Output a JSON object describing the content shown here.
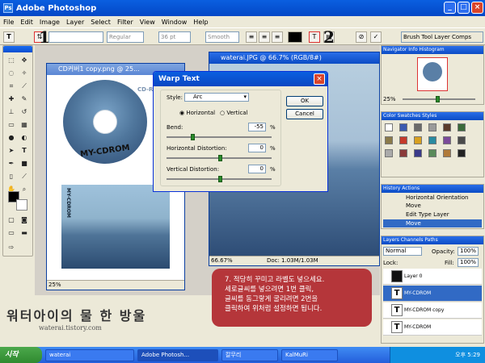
{
  "app": {
    "title": "Adobe Photoshop"
  },
  "menu": [
    "File",
    "Edit",
    "Image",
    "Layer",
    "Select",
    "Filter",
    "View",
    "Window",
    "Help"
  ],
  "options": {
    "font_style": "Regular",
    "font_size": "36 pt",
    "antialias": "Smooth",
    "palette_tabs": "Brush Tool Layer Comps"
  },
  "docs": [
    {
      "title": "CD커버1 copy.png @ 25...",
      "zoom": "25%"
    },
    {
      "title": "waterai.JPG @ 66.7% (RGB/8#)",
      "zoom": "66.67%",
      "docinfo": "Doc: 1.03M/1.03M"
    }
  ],
  "cd": {
    "label": "MY-CDROM",
    "text_top": "CD-ROM"
  },
  "warp": {
    "title": "Warp Text",
    "style_label": "Style:",
    "style_value": "Arc",
    "horizontal": "Horizontal",
    "vertical": "Vertical",
    "bend_label": "Bend:",
    "bend_value": "-55",
    "hdist_label": "Horizontal Distortion:",
    "hdist_value": "0",
    "vdist_label": "Vertical Distortion:",
    "vdist_value": "0",
    "pct": "%",
    "ok": "OK",
    "cancel": "Cancel"
  },
  "navigator": {
    "tabs": "Navigator  Info  Histogram",
    "zoom": "25%"
  },
  "swatches": {
    "tabs": "Color  Swatches  Styles"
  },
  "history": {
    "tabs": "History  Actions",
    "items": [
      "Horizontal Orientation",
      "Move",
      "Edit Type Layer",
      "Move"
    ]
  },
  "layers": {
    "tabs": "Layers  Channels  Paths",
    "blend": "Normal",
    "opacity_label": "Opacity:",
    "opacity": "100%",
    "lock_label": "Lock:",
    "fill_label": "Fill:",
    "fill": "100%",
    "items": [
      "Layer 0",
      "MY-CDROM",
      "MY-CDROM copy",
      "MY-CDROM"
    ]
  },
  "caption": [
    "7. 적당히 꾸미고 라벨도 넣으세요.",
    "세로글씨를 넣으려면 1번 클릭,",
    "글씨를 동그랗게 굴리려면 2번을",
    "클릭하여 위처럼 설정하면 됩니다."
  ],
  "marks": {
    "one": "1",
    "two": "2"
  },
  "watermark": {
    "title": "워터아이의 물 한 방울",
    "url": "waterai.tistory.com"
  },
  "taskbar": {
    "start": "시작",
    "tasks": [
      "waterai",
      "Adobe Photosh...",
      "칼무리",
      "KalMuRi"
    ],
    "clock": "오후 5:29"
  }
}
